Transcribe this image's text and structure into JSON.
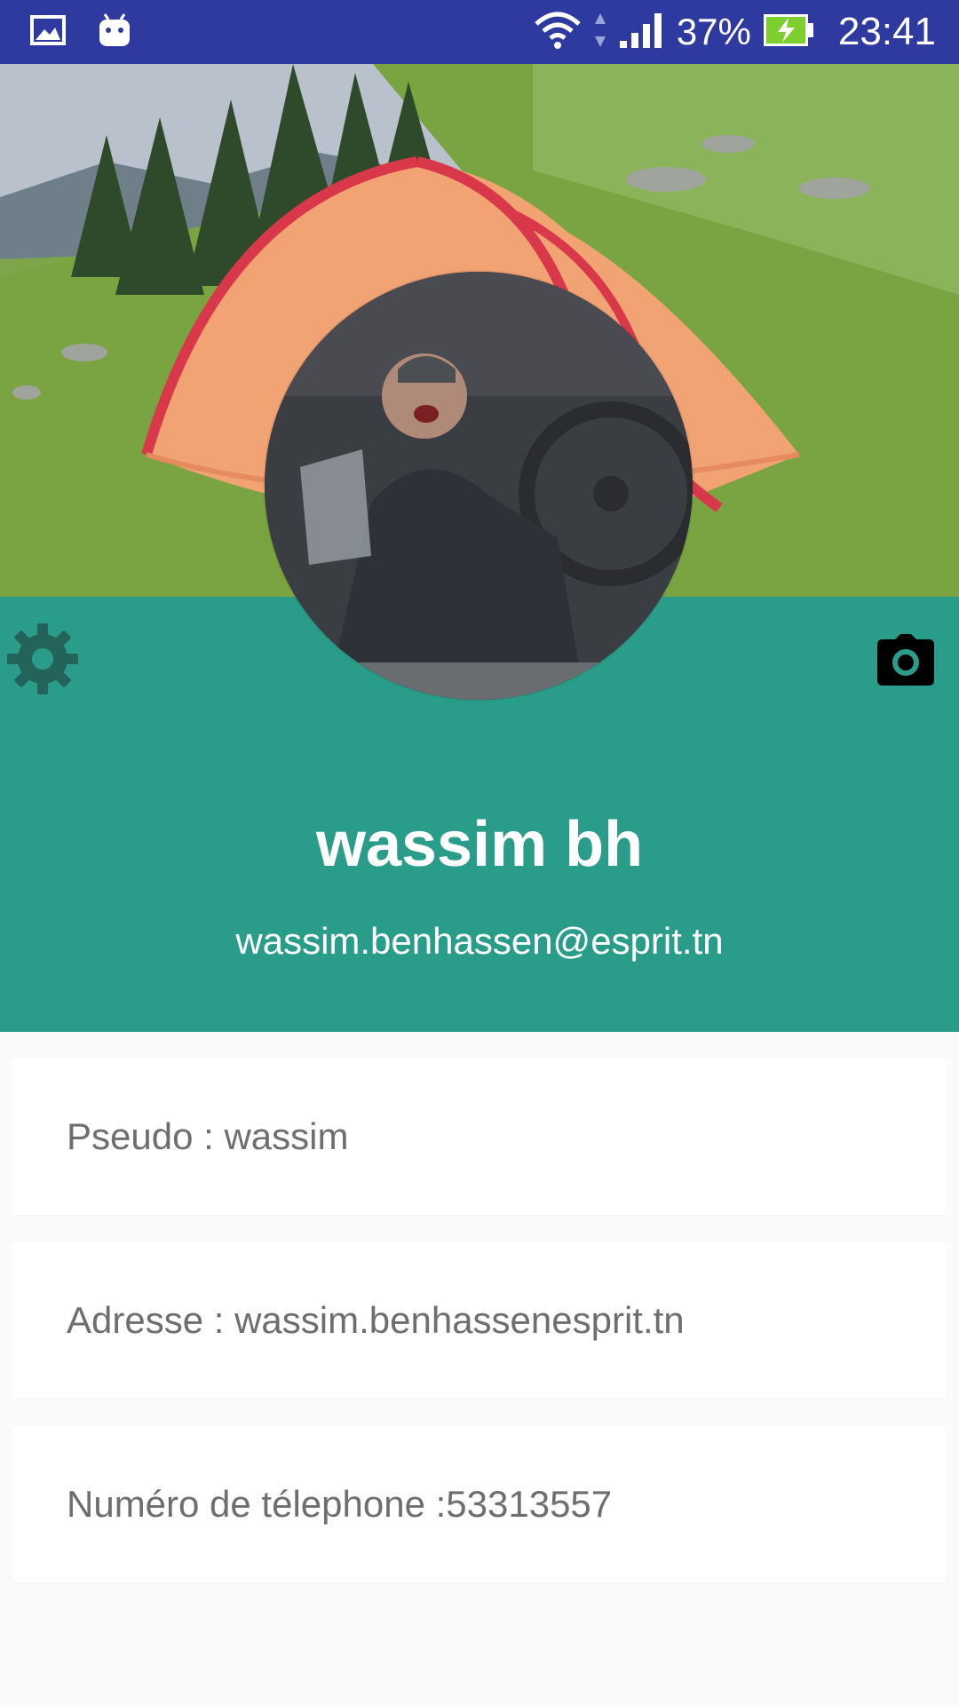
{
  "status_bar": {
    "battery": "37%",
    "time": "23:41",
    "left_icons": [
      "gallery-icon",
      "android-icon"
    ],
    "right_icons": [
      "wifi-icon",
      "data-arrows-icon",
      "signal-icon",
      "battery-charging-icon"
    ]
  },
  "header": {
    "cover_image": "tent-in-meadow",
    "avatar_image": "profile-photo",
    "settings_icon": "gear-icon",
    "camera_icon": "camera-icon",
    "name": "wassim bh",
    "email": "wassim.benhassen@esprit.tn"
  },
  "details": [
    {
      "label": "Pseudo : wassim"
    },
    {
      "label": "Adresse : wassim.benhassenesprit.tn"
    },
    {
      "label": "Numéro de télephone :53313557"
    }
  ],
  "colors": {
    "status_bar": "#2e3a9f",
    "header_band": "#2a9d8a",
    "card_text": "#6e6e6e",
    "gear": "#23635a"
  }
}
